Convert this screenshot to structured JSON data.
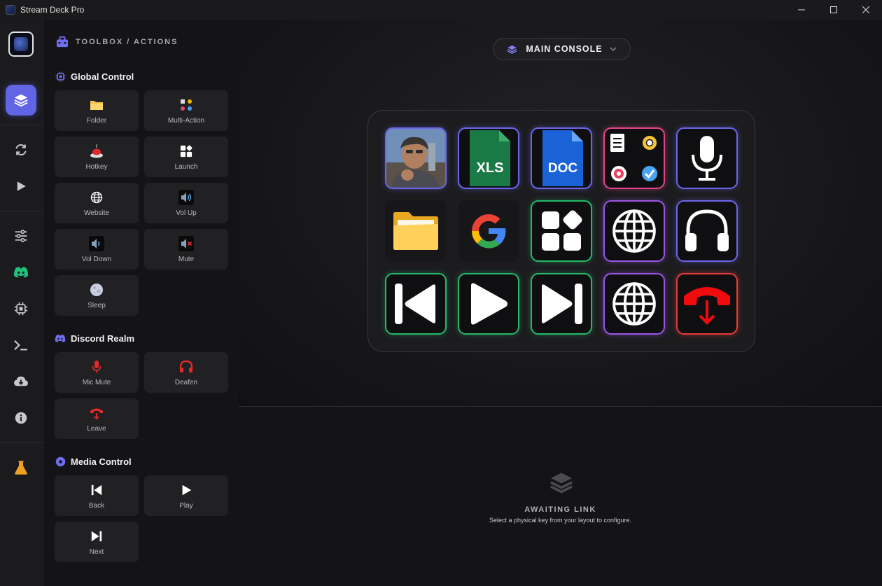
{
  "window": {
    "title": "Stream Deck Pro"
  },
  "toolbox": {
    "header": "TOOLBOX / ACTIONS",
    "sections": [
      {
        "title": "Global Control",
        "items": [
          "Folder",
          "Multi-Action",
          "Hotkey",
          "Launch",
          "Website",
          "Vol Up",
          "Vol Down",
          "Mute",
          "Sleep"
        ]
      },
      {
        "title": "Discord Realm",
        "items": [
          "Mic Mute",
          "Deafen",
          "Leave"
        ]
      },
      {
        "title": "Media Control",
        "items": [
          "Back",
          "Play",
          "Next"
        ]
      }
    ]
  },
  "console": {
    "label": "MAIN CONSOLE"
  },
  "deck": {
    "keys": [
      {
        "icon": "photo-icon",
        "text": ""
      },
      {
        "icon": "xls-file-icon",
        "text": "XLS"
      },
      {
        "icon": "doc-file-icon",
        "text": "DOC"
      },
      {
        "icon": "workflow-icon",
        "text": ""
      },
      {
        "icon": "microphone-icon",
        "text": ""
      },
      {
        "icon": "folder-icon",
        "text": ""
      },
      {
        "icon": "google-icon",
        "text": ""
      },
      {
        "icon": "apps-icon",
        "text": ""
      },
      {
        "icon": "globe-icon",
        "text": ""
      },
      {
        "icon": "headphones-icon",
        "text": ""
      },
      {
        "icon": "previous-track-icon",
        "text": ""
      },
      {
        "icon": "play-icon",
        "text": ""
      },
      {
        "icon": "next-track-icon",
        "text": ""
      },
      {
        "icon": "globe-icon",
        "text": ""
      },
      {
        "icon": "hang-up-icon",
        "text": ""
      }
    ]
  },
  "inspector": {
    "title": "AWAITING LINK",
    "subtitle": "Select a physical key from your layout to configure."
  },
  "colors": {
    "accent": "#6264e6",
    "discord": "#23c17a",
    "danger": "#e73a3a",
    "flask": "#f0a020"
  }
}
